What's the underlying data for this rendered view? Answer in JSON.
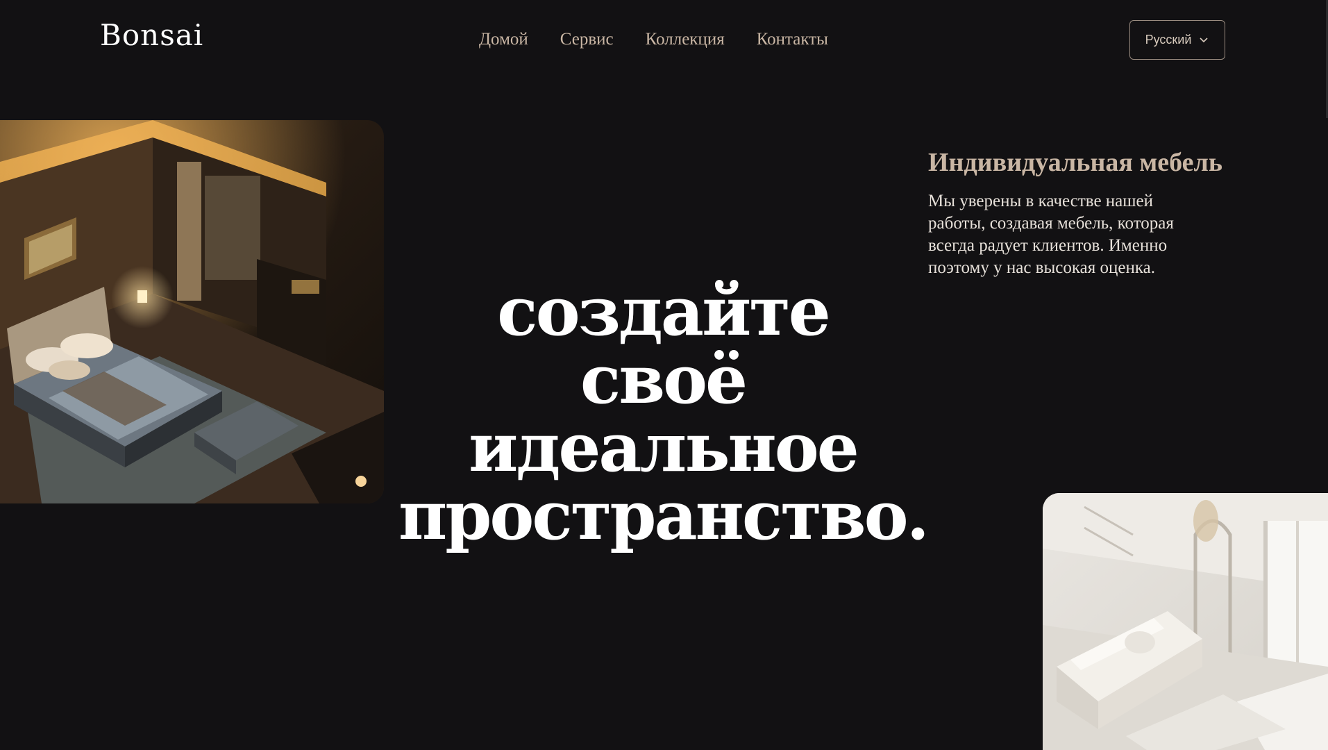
{
  "header": {
    "logo": "Bonsai",
    "nav": [
      "Домой",
      "Сервис",
      "Коллекция",
      "Контакты"
    ],
    "language": "Русский"
  },
  "hero": {
    "lines": [
      "создайте",
      "своё",
      "идеальное",
      "пространство."
    ]
  },
  "feature": {
    "title": "Индивидуальная мебель",
    "text": "Мы уверены в качестве нашей работы, создавая мебель, которая всегда радует клиентов. Именно поэтому у нас высокая оценка."
  },
  "colors": {
    "background": "#121113",
    "accent": "#c9b6a4",
    "headline": "#ffffff"
  },
  "icons": {
    "language_dropdown": "chevron-down-icon"
  }
}
